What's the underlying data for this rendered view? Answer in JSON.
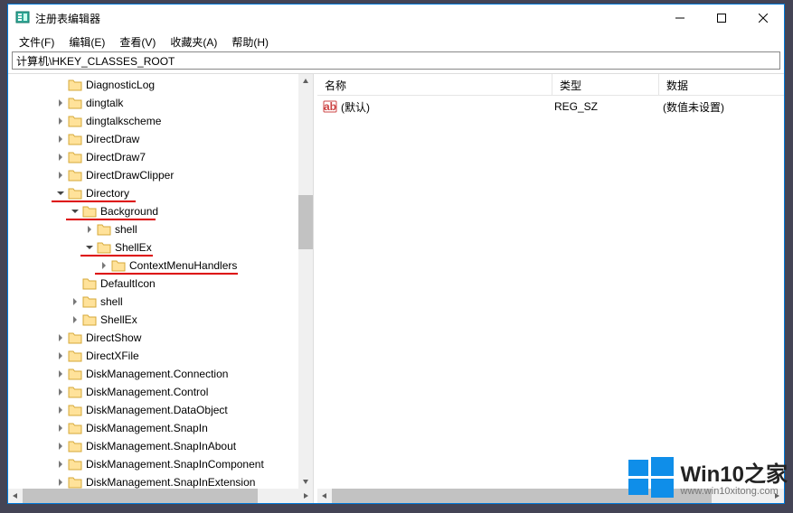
{
  "window": {
    "title": "注册表编辑器"
  },
  "menus": {
    "file": "文件(F)",
    "edit": "编辑(E)",
    "view": "查看(V)",
    "favorites": "收藏夹(A)",
    "help": "帮助(H)"
  },
  "address": "计算机\\HKEY_CLASSES_ROOT",
  "tree": [
    {
      "indent": 3,
      "exp": "",
      "label": "DiagnosticLog"
    },
    {
      "indent": 3,
      "exp": ">",
      "label": "dingtalk"
    },
    {
      "indent": 3,
      "exp": ">",
      "label": "dingtalkscheme"
    },
    {
      "indent": 3,
      "exp": ">",
      "label": "DirectDraw"
    },
    {
      "indent": 3,
      "exp": ">",
      "label": "DirectDraw7"
    },
    {
      "indent": 3,
      "exp": ">",
      "label": "DirectDrawClipper"
    },
    {
      "indent": 3,
      "exp": "v",
      "label": "Directory",
      "underline": true
    },
    {
      "indent": 4,
      "exp": "v",
      "label": "Background",
      "underline": true
    },
    {
      "indent": 5,
      "exp": ">",
      "label": "shell"
    },
    {
      "indent": 5,
      "exp": "v",
      "label": "ShellEx",
      "underline": true
    },
    {
      "indent": 6,
      "exp": ">",
      "label": "ContextMenuHandlers",
      "underline": true
    },
    {
      "indent": 4,
      "exp": "",
      "label": "DefaultIcon"
    },
    {
      "indent": 4,
      "exp": ">",
      "label": "shell"
    },
    {
      "indent": 4,
      "exp": ">",
      "label": "ShellEx"
    },
    {
      "indent": 3,
      "exp": ">",
      "label": "DirectShow"
    },
    {
      "indent": 3,
      "exp": ">",
      "label": "DirectXFile"
    },
    {
      "indent": 3,
      "exp": ">",
      "label": "DiskManagement.Connection"
    },
    {
      "indent": 3,
      "exp": ">",
      "label": "DiskManagement.Control"
    },
    {
      "indent": 3,
      "exp": ">",
      "label": "DiskManagement.DataObject"
    },
    {
      "indent": 3,
      "exp": ">",
      "label": "DiskManagement.SnapIn"
    },
    {
      "indent": 3,
      "exp": ">",
      "label": "DiskManagement.SnapInAbout"
    },
    {
      "indent": 3,
      "exp": ">",
      "label": "DiskManagement.SnapInComponent"
    },
    {
      "indent": 3,
      "exp": ">",
      "label": "DiskManagement.SnapInExtension"
    }
  ],
  "columns": {
    "name": "名称",
    "type": "类型",
    "data": "数据"
  },
  "values": [
    {
      "name": "(默认)",
      "type": "REG_SZ",
      "data": "(数值未设置)"
    }
  ],
  "watermark": {
    "title": "Win10之家",
    "url": "www.win10xitong.com"
  }
}
